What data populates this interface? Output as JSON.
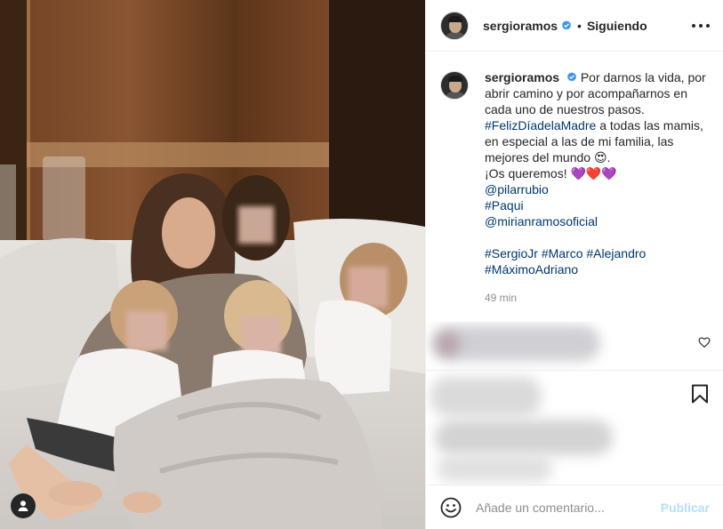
{
  "post": {
    "username": "sergioramos",
    "follow_label": "Siguiendo",
    "separator": "•",
    "caption": {
      "username": "sergioramos",
      "line1": "Por darnos la vida, por abrir camino y por acompañarnos en cada uno de nuestros pasos.",
      "hashtag_main": "#FelizDíadelaMadre",
      "line2": "a todas las mamis, en especial a las de mi familia, las mejores del mundo 😍.",
      "line3": "¡Os queremos! 💜❤️💜",
      "mention1": "@pilarrubio",
      "mention2": "#Paqui",
      "mention3": "@mirianramosoficial",
      "tags": [
        "#SergioJr",
        "#Marco",
        "#Alejandro",
        "#MáximoAdriano"
      ]
    },
    "time_ago": "49 min"
  },
  "comment_box": {
    "placeholder": "Añade un comentario...",
    "publish_label": "Publicar"
  },
  "colors": {
    "link": "#00376b",
    "verified": "#3897f0",
    "publish_disabled": "#b2dffc",
    "muted": "#8e8e8e"
  },
  "icons": [
    "verified-badge-icon",
    "more-options-icon",
    "heart-icon",
    "bookmark-icon",
    "emoji-icon",
    "user-tag-icon"
  ]
}
